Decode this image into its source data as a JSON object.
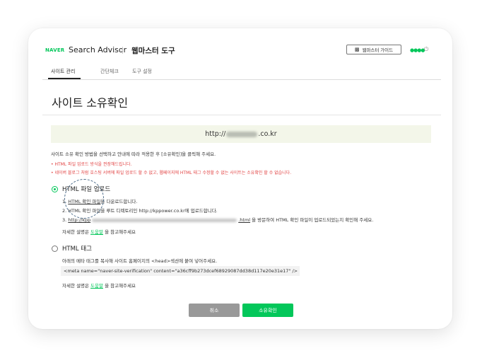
{
  "header": {
    "logo": "NAVER",
    "product": "Search Advisor",
    "tool": "웹마스터 도구",
    "guide_button": "웹마스터 가이드",
    "guide_icon": "book-icon",
    "user_dots": "●●●●",
    "power_icon": "power-icon"
  },
  "tabs": [
    {
      "label": "사이트 관리",
      "active": true
    },
    {
      "label": "간단체크",
      "active": false
    },
    {
      "label": "도구 설정",
      "active": false
    }
  ],
  "page": {
    "title": "사이트 소유확인",
    "url_prefix": "http://",
    "url_suffix": ".co.kr",
    "instruction": "사이트 소유 확인 방법을 선택하고 안내에 따라 적용한 후 [소유확인]을 클릭해 주세요.",
    "warnings": [
      "• HTML 파일 업로드 방식을 권장해드립니다.",
      "• 네이버 블로그 처럼 호스팅 서버에 파일 업로드 할 수 없고, 웹페이지에 HTML 태그 수정할 수 없는 사이트는 소유확인 할 수 없습니다."
    ]
  },
  "option_html_file": {
    "title": "HTML 파일 업로드",
    "selected": true,
    "step1_num": "1.",
    "step1_link": "HTML 확인 파일",
    "step1_rest": "을 다운로드합니다.",
    "step2": "2. HTML 확인 파일을 루트 디렉토리인 http://kppower.co.kr에 업로드합니다.",
    "step3_num": "3.",
    "step3_link_start": "http://kpp",
    "step3_link_end": ".html",
    "step3_rest": "을 방문하여 HTML 확인 파일이 업로드되었는지 확인해 주세요.",
    "help_prefix": "자세한 설명은",
    "help_link": "도움말",
    "help_suffix": "을 참고해주세요"
  },
  "option_html_tag": {
    "title": "HTML 태그",
    "selected": false,
    "desc": "아래의 메타 태그를 복사해 사이트 홈페이지의 <head>섹션에 붙여 넣어주세요.",
    "meta_tag": "<meta name=\"naver-site-verification\" content=\"a36cff9b273dcef68929087dd38d117e20e31e17\" />",
    "help_prefix": "자세한 설명은",
    "help_link": "도움말",
    "help_suffix": "을 참고해주세요"
  },
  "buttons": {
    "cancel": "취소",
    "confirm": "소유확인"
  },
  "colors": {
    "accent": "#03c75a",
    "warning": "#e24444",
    "url_bg": "#f3f6e9",
    "cancel_bg": "#999999"
  }
}
